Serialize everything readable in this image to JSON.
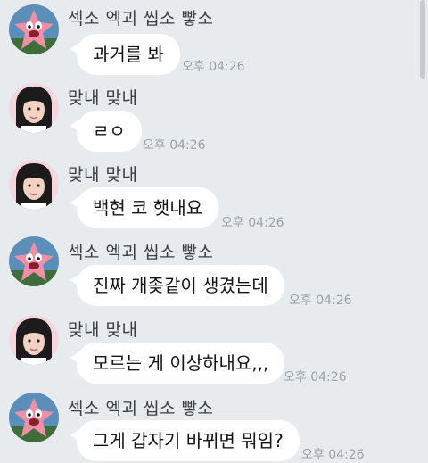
{
  "senders": {
    "sexo": "섹소 엑괴 씹소 빻소",
    "maknae": "맞내 맞내"
  },
  "messages": [
    {
      "sender": "섹소 엑괴 씹소 빻소",
      "text": "과거를 봐",
      "time": "오후 04:26"
    },
    {
      "sender": "맞내 맞내",
      "text": "ㄹㅇ",
      "time": "오후 04:26"
    },
    {
      "sender": "맞내 맞내",
      "text": "백현 코 햇내요",
      "time": "오후 04:26"
    },
    {
      "sender": "섹소 엑괴 씹소 빻소",
      "text": "진짜 개좆같이 생겼는데",
      "time": "오후 04:26"
    },
    {
      "sender": "맞내 맞내",
      "text": "모르는 게 이상하내요,,,",
      "time": "오후 04:26"
    },
    {
      "sender": "섹소 엑괴 씹소 빻소",
      "text": "그게 갑자기 바뀌면 뭐임?",
      "time": "오후 04:26"
    }
  ],
  "colors": {
    "background": "#e8ebee",
    "bubble": "#ffffff",
    "time": "#9aa1a8"
  },
  "icons": {
    "sexo_avatar": "starfish-avatar-icon",
    "maknae_avatar": "person-avatar-icon"
  }
}
